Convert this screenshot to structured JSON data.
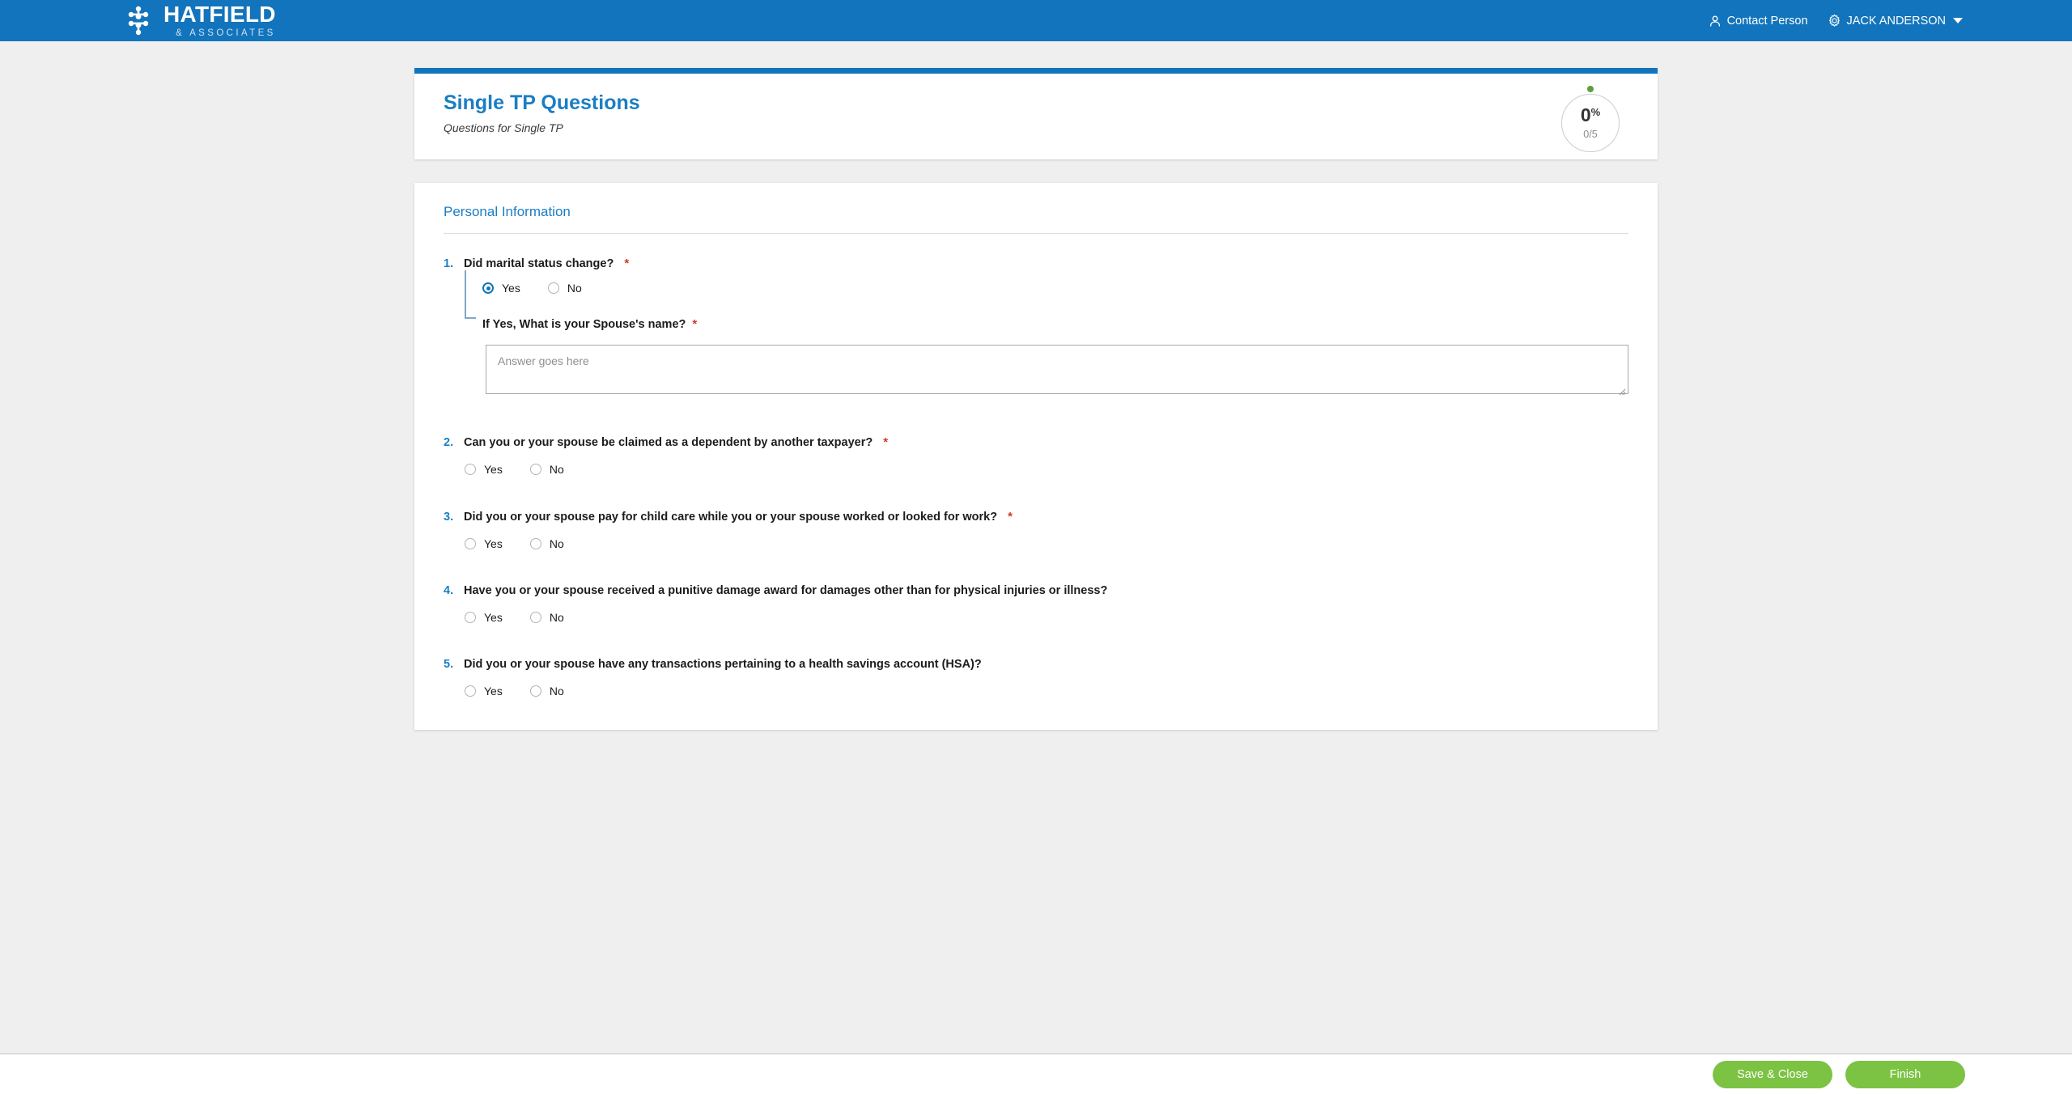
{
  "topbar": {
    "brand": {
      "name": "HATFIELD",
      "tagline": "& ASSOCIATES",
      "logo_icon": "network-nodes-icon"
    },
    "contact_person": {
      "label": "Contact Person",
      "icon": "person-icon"
    },
    "user_menu": {
      "label": "JACK ANDERSON",
      "icon": "gear-icon",
      "caret": "chevron-down-icon"
    },
    "background_color": "#1274bc"
  },
  "header_card": {
    "title": "Single TP Questions",
    "subtitle": "Questions for Single TP",
    "accent_color": "#1274bc",
    "progress": {
      "percent_value": "0",
      "percent_symbol": "%",
      "fraction": "0/5",
      "dot_color": "#5e9e3c"
    }
  },
  "form": {
    "section_title": "Personal Information",
    "questions": [
      {
        "number": "1.",
        "text": "Did marital status change?",
        "required": true,
        "options": [
          {
            "label": "Yes",
            "selected": true
          },
          {
            "label": "No",
            "selected": false
          }
        ],
        "sub_question": {
          "text": "If Yes, What is your Spouse's name?",
          "required": true,
          "input_value": "",
          "placeholder": "Answer goes here"
        }
      },
      {
        "number": "2.",
        "text": "Can you or your spouse be claimed as a dependent by another taxpayer?",
        "required": true,
        "options": [
          {
            "label": "Yes",
            "selected": false
          },
          {
            "label": "No",
            "selected": false
          }
        ]
      },
      {
        "number": "3.",
        "text": "Did you or your spouse pay for child care while you or your spouse worked or looked for work?",
        "required": true,
        "options": [
          {
            "label": "Yes",
            "selected": false
          },
          {
            "label": "No",
            "selected": false
          }
        ]
      },
      {
        "number": "4.",
        "text": "Have you or your spouse received a punitive damage award for damages other than for physical injuries or illness?",
        "required": false,
        "options": [
          {
            "label": "Yes",
            "selected": false
          },
          {
            "label": "No",
            "selected": false
          }
        ]
      },
      {
        "number": "5.",
        "text": "Did you or your spouse have any transactions pertaining to a health savings account (HSA)?",
        "required": false,
        "options": [
          {
            "label": "Yes",
            "selected": false
          },
          {
            "label": "No",
            "selected": false
          }
        ]
      }
    ]
  },
  "footer": {
    "save_close_label": "Save & Close",
    "finish_label": "Finish",
    "button_color": "#7cc243"
  }
}
